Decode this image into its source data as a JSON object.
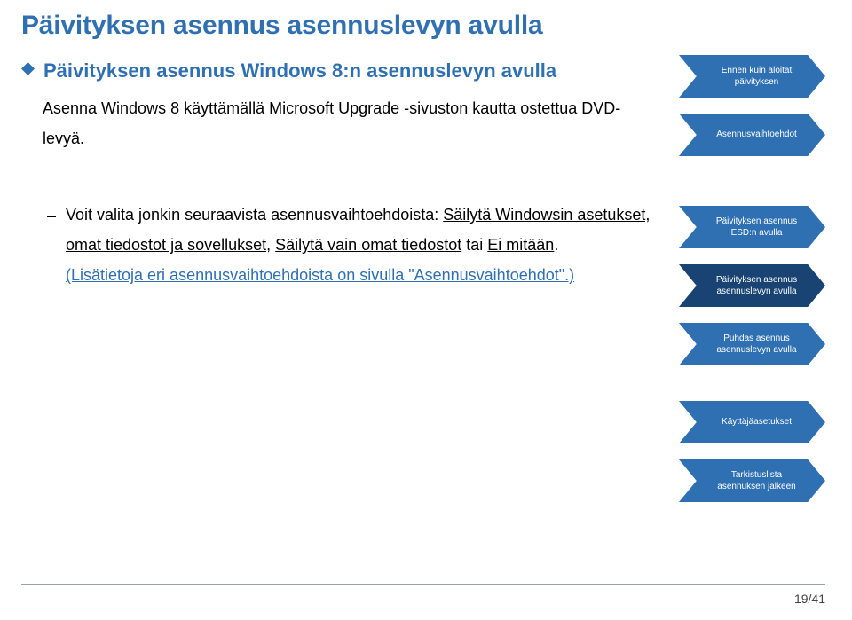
{
  "title": "Päivityksen asennus asennuslevyn avulla",
  "section1": {
    "subtitle": "Päivityksen asennus Windows 8:n asennuslevyn avulla",
    "body": "Asenna Windows 8 käyttämällä Microsoft Upgrade -sivuston kautta ostettua DVD-levyä."
  },
  "section2": {
    "pre": "Voit valita jonkin seuraavista asennusvaihtoehdoista: ",
    "opt1": "Säilytä Windowsin asetukset, omat tiedostot ja sovellukset",
    "sep1": ", ",
    "opt2": "Säilytä vain omat tiedostot",
    "sep2": " tai ",
    "opt3": "Ei mitään",
    "period": ".",
    "link": "(Lisätietoja eri asennusvaihtoehdoista on sivulla \"Asennusvaihtoehdot\".)"
  },
  "nav": {
    "g1": [
      "Ennen kuin aloitat\npäivityksen",
      "Asennusvaihtoehdot"
    ],
    "g2": [
      "Päivityksen asennus\nESD:n avulla",
      "Päivityksen asennus\nasennuslevyn avulla",
      "Puhdas asennus\nasennuslevyn avulla"
    ],
    "g3": [
      "Käyttäjäasetukset",
      "Tarkistuslista\nasennuksen jälkeen"
    ],
    "active_index": "g2.1"
  },
  "footer": "19/41"
}
